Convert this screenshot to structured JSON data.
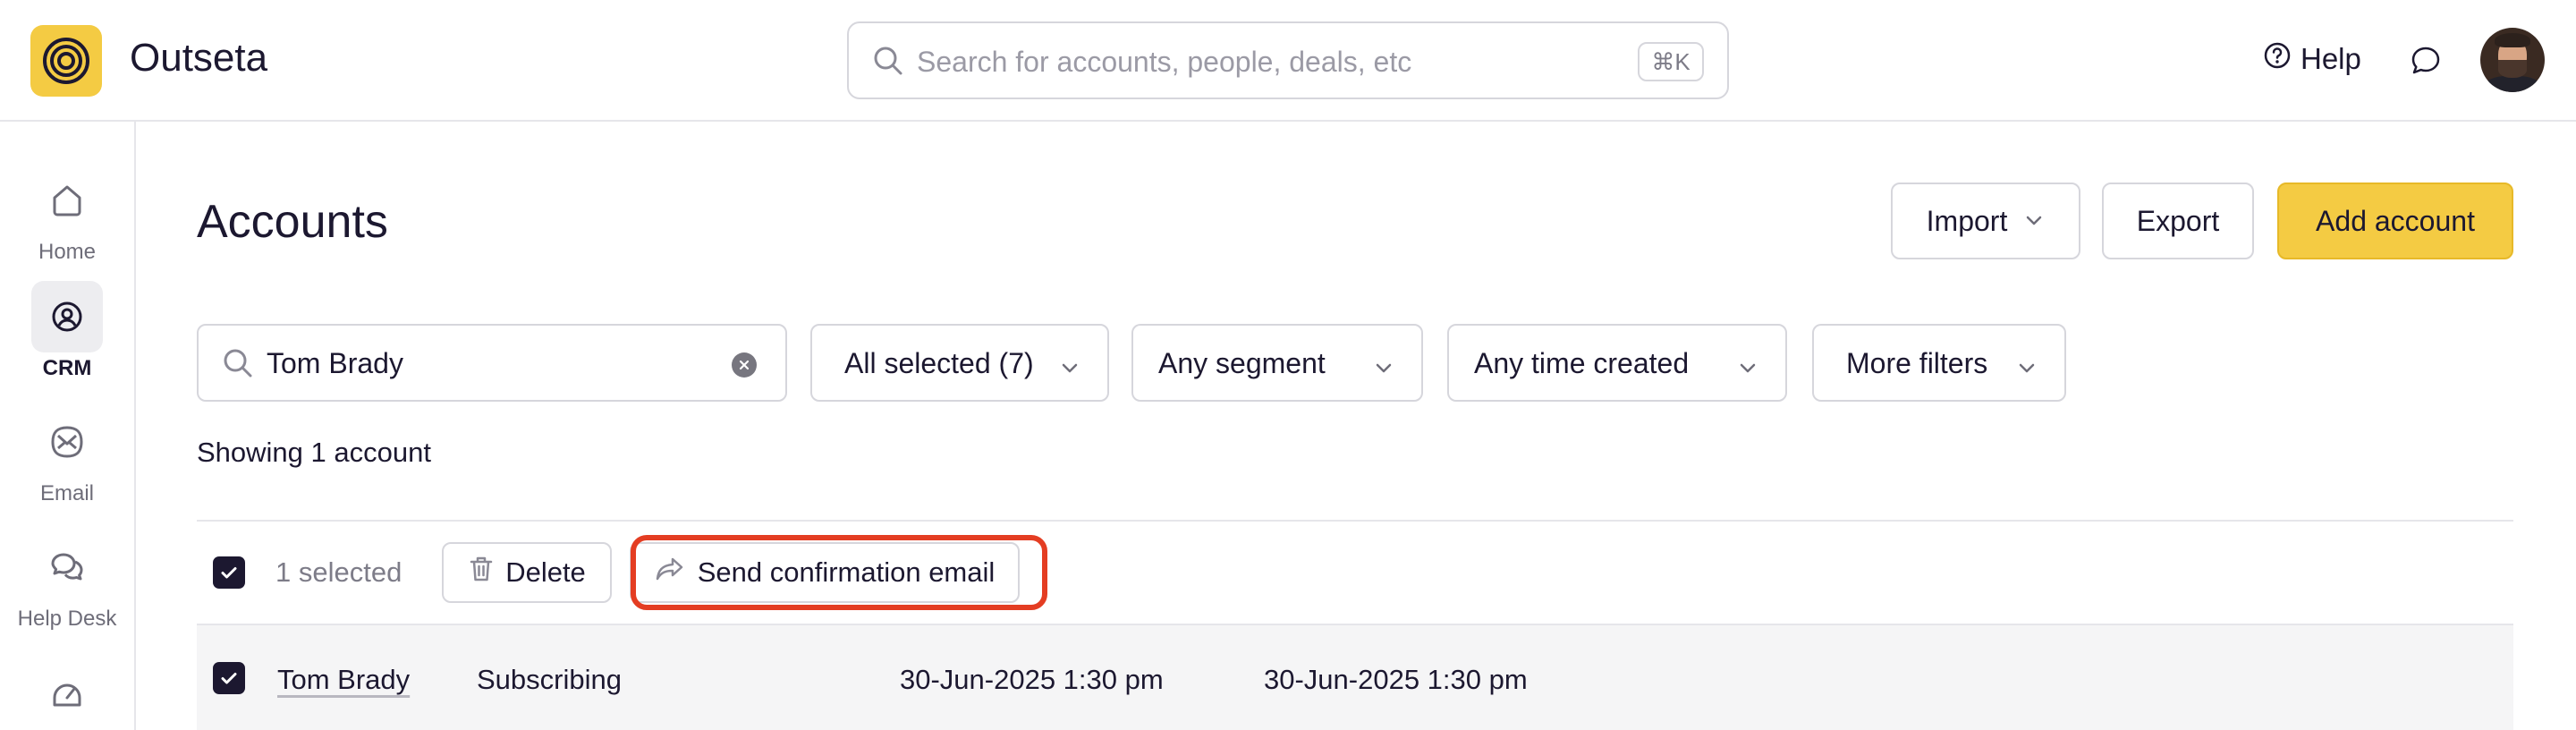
{
  "app": {
    "name": "Outseta",
    "colors": {
      "brand": "#f4cb43",
      "text": "#1c1830",
      "highlight": "#e43d22",
      "muted": "#7d7c88"
    }
  },
  "header": {
    "search_placeholder": "Search for accounts, people, deals, etc",
    "shortcut": "⌘K",
    "help_label": "Help",
    "icons": [
      "logo-icon",
      "search-icon",
      "help-icon",
      "chat-icon",
      "user-avatar"
    ]
  },
  "sidebar": {
    "items": [
      {
        "label": "Home",
        "icon": "home-icon",
        "active": false
      },
      {
        "label": "CRM",
        "icon": "crm-icon",
        "active": true
      },
      {
        "label": "Email",
        "icon": "email-icon",
        "active": false
      },
      {
        "label": "Help Desk",
        "icon": "help-desk-icon",
        "active": false
      }
    ]
  },
  "page": {
    "title": "Accounts",
    "actions": {
      "import": "Import",
      "export": "Export",
      "add": "Add account"
    }
  },
  "filters": {
    "search_value": "Tom Brady",
    "status": "All selected (7)",
    "segment": "Any segment",
    "created": "Any time created",
    "more": "More filters"
  },
  "results": {
    "showing": "Showing 1 account"
  },
  "bulk": {
    "selected": "1 selected",
    "delete": "Delete",
    "send_confirmation": "Send confirmation email"
  },
  "rows": [
    {
      "name": "Tom Brady",
      "status": "Subscribing",
      "created": "30-Jun-2025 1:30 pm",
      "updated": "30-Jun-2025 1:30 pm",
      "selected": true
    }
  ]
}
